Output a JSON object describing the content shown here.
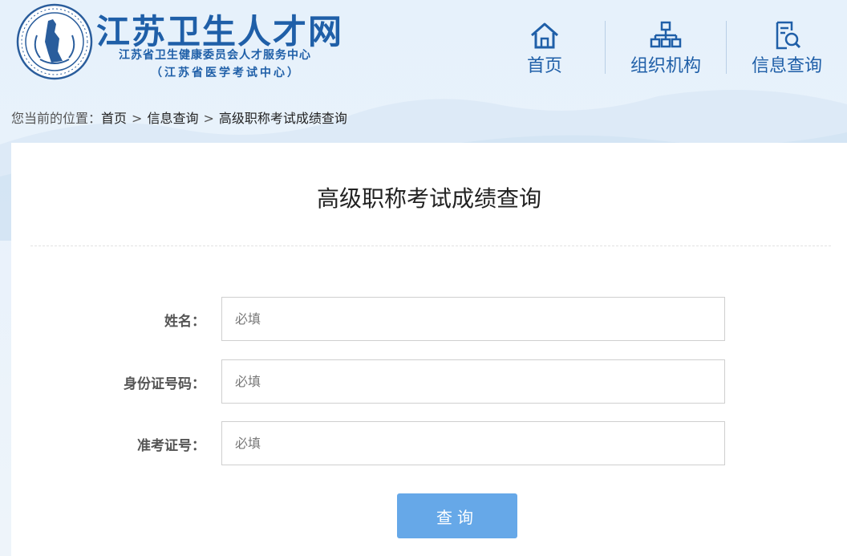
{
  "header": {
    "title": "江苏卫生人才网",
    "subtitle1": "江苏省卫生健康委员会人才服务中心",
    "subtitle2": "（江苏省医学考试中心）"
  },
  "nav": {
    "items": [
      {
        "label": "首页",
        "icon": "home-icon"
      },
      {
        "label": "组织机构",
        "icon": "org-chart-icon"
      },
      {
        "label": "信息查询",
        "icon": "search-document-icon"
      }
    ]
  },
  "breadcrumb": {
    "prefix": "您当前的位置：",
    "items": [
      "首页",
      "信息查询",
      "高级职称考试成绩查询"
    ],
    "separator": ">"
  },
  "form": {
    "title": "高级职称考试成绩查询",
    "fields": [
      {
        "label": "姓名：",
        "value": "",
        "placeholder": "必填"
      },
      {
        "label": "身份证号码：",
        "value": "",
        "placeholder": "必填"
      },
      {
        "label": "准考证号：",
        "value": "",
        "placeholder": "必填"
      }
    ],
    "submit_label": "查询"
  },
  "colors": {
    "brand": "#1f5fa8",
    "button": "#66a8e8",
    "background": "#e6f1fb"
  }
}
